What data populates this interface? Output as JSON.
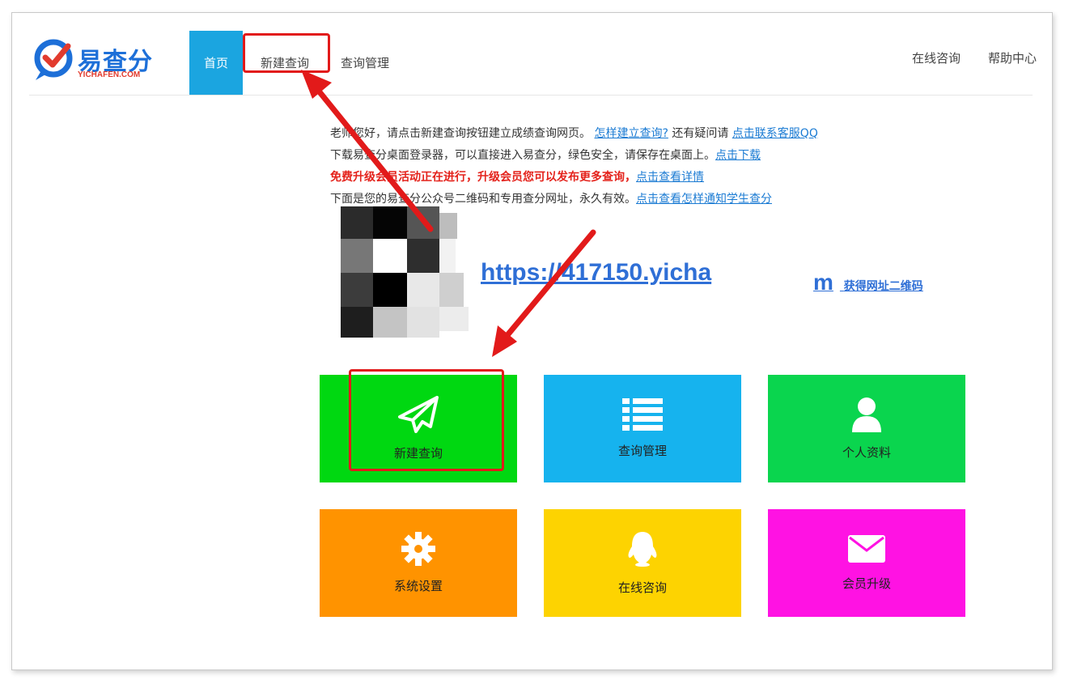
{
  "logo": {
    "name": "易查分",
    "sub": "YICHAFEN.COM"
  },
  "nav": {
    "home": "首页",
    "new_query": "新建查询",
    "query_manage": "查询管理",
    "online_consult": "在线咨询",
    "help_center": "帮助中心"
  },
  "info": {
    "line1": {
      "text": "老师您好，请点击新建查询按钮建立成绩查询网页。",
      "link1": "怎样建立查询?",
      "text2": "还有疑问请",
      "link2": "点击联系客服QQ"
    },
    "line2": {
      "text": "下载易查分桌面登录器，可以直接进入易查分，绿色安全，请保存在桌面上。",
      "link": "点击下载"
    },
    "line3": {
      "text": "免费升级会员活动正在进行，升级会员您可以发布更多查询，",
      "link": "点击查看详情"
    },
    "line4": {
      "text": "下面是您的易查分公众号二维码和专用查分网址，永久有效。",
      "link": "点击查看怎样通知学生查分"
    }
  },
  "url": {
    "text": "https://417150.yicha",
    "qr_link": "获得网址二维码",
    "tail": "m"
  },
  "tiles": [
    {
      "label": "新建查询",
      "color": "#00d811",
      "icon": "paper-plane-icon"
    },
    {
      "label": "查询管理",
      "color": "#16b3ee",
      "icon": "list-icon"
    },
    {
      "label": "个人资料",
      "color": "#0ad54e",
      "icon": "user-icon"
    },
    {
      "label": "系统设置",
      "color": "#ff9300",
      "icon": "gear-icon"
    },
    {
      "label": "在线咨询",
      "color": "#fdd301",
      "icon": "qq-penguin-icon"
    },
    {
      "label": "会员升级",
      "color": "#ff12e3",
      "icon": "mail-icon"
    }
  ],
  "colors": {
    "accent": "#1ba5e0",
    "annotation": "#e21a1a",
    "link": "#1b7bd3"
  }
}
